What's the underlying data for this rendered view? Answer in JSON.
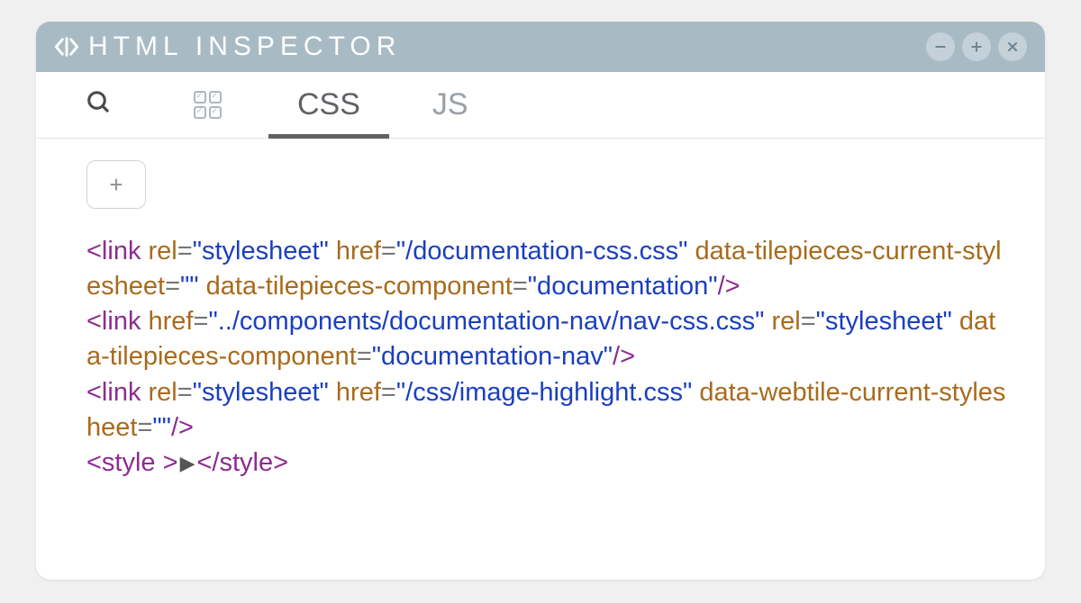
{
  "titlebar": {
    "title": "HTML INSPECTOR"
  },
  "tabs": {
    "css": "CSS",
    "js": "JS"
  },
  "add_button": "+",
  "code": {
    "links": [
      {
        "tag": "link",
        "attrs": [
          {
            "name": "rel",
            "value": "stylesheet"
          },
          {
            "name": "href",
            "value": "/documentation-css.css"
          },
          {
            "name": "data-tilepieces-current-stylesheet",
            "value": ""
          },
          {
            "name": "data-tilepieces-component",
            "value": "documentation"
          }
        ]
      },
      {
        "tag": "link",
        "attrs": [
          {
            "name": "href",
            "value": "../components/documentation-nav/nav-css.css"
          },
          {
            "name": "rel",
            "value": "stylesheet"
          },
          {
            "name": "data-tilepieces-component",
            "value": "documentation-nav"
          }
        ]
      },
      {
        "tag": "link",
        "attrs": [
          {
            "name": "rel",
            "value": "stylesheet"
          },
          {
            "name": "href",
            "value": "/css/image-highlight.css"
          },
          {
            "name": "data-webtile-current-stylesheet",
            "value": ""
          }
        ]
      }
    ],
    "style_tag": "style"
  }
}
